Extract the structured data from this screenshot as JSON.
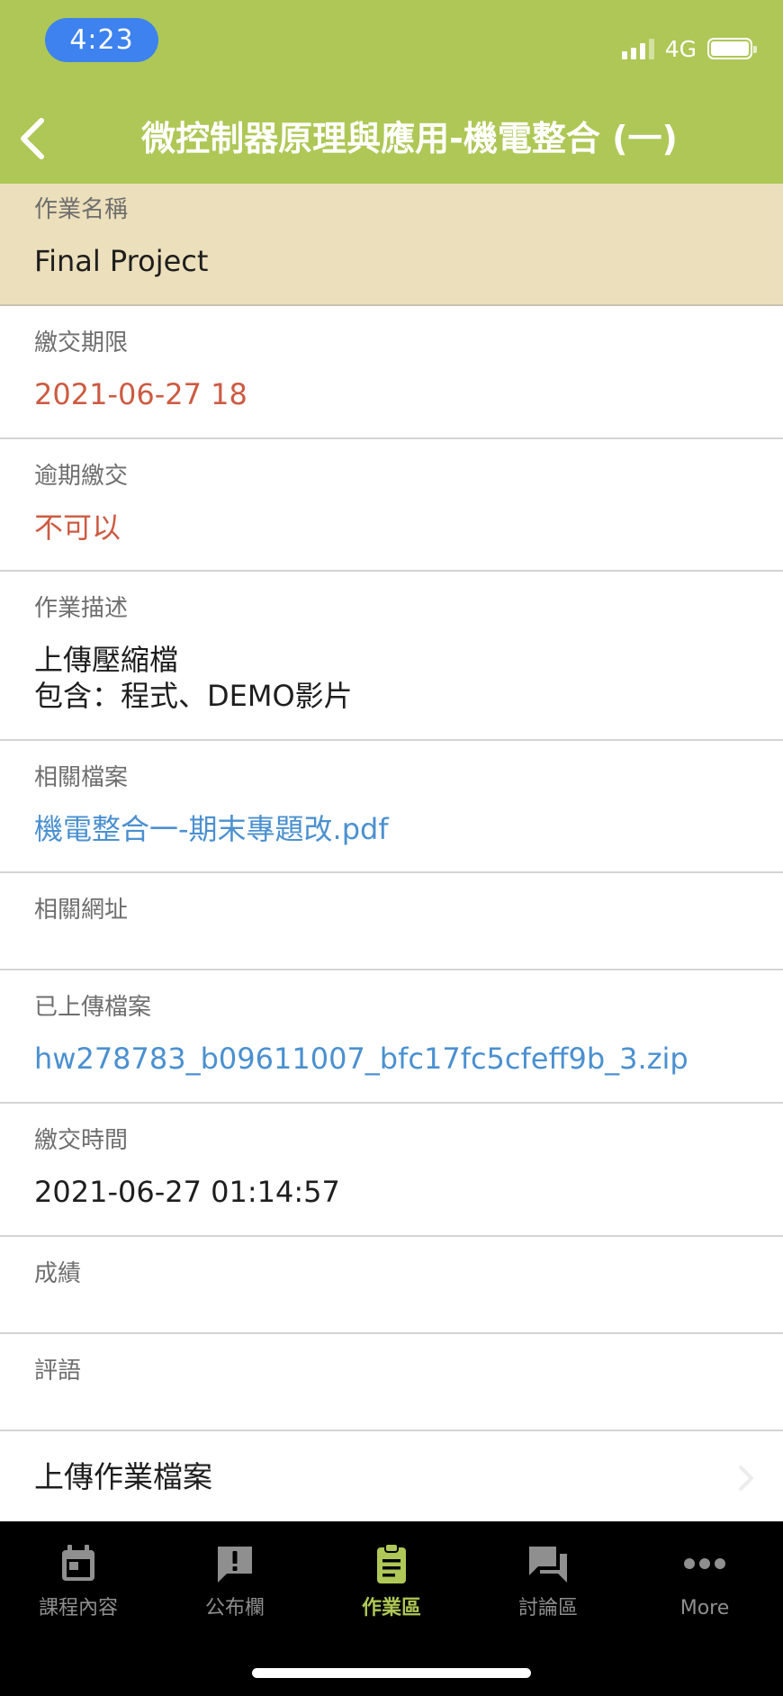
{
  "status_bar": {
    "time": "4:23",
    "network": "4G"
  },
  "header": {
    "title": "微控制器原理與應用-機電整合 (一)",
    "background_color": "#aec756",
    "back_icon": "chevron-left-icon"
  },
  "assignment": {
    "name_label": "作業名稱",
    "name_value": "Final Project",
    "deadline_label": "繳交期限",
    "deadline_value": "2021-06-27 18",
    "late_label": "逾期繳交",
    "late_value": "不可以",
    "description_label": "作業描述",
    "description_line1": "上傳壓縮檔",
    "description_line2": "包含：程式、DEMO影片",
    "files_label": "相關檔案",
    "files_value": "機電整合一-期末專題改.pdf",
    "urls_label": "相關網址",
    "urls_value": "",
    "uploaded_label": "已上傳檔案",
    "uploaded_value": "hw278783_b09611007_bfc17fc5cfeff9b_3.zip",
    "submit_time_label": "繳交時間",
    "submit_time_value": "2021-06-27 01:14:57",
    "grade_label": "成績",
    "grade_value": "",
    "comment_label": "評語",
    "comment_value": "",
    "upload_action": "上傳作業檔案"
  },
  "tabbar": {
    "tabs": [
      {
        "label": "課程內容",
        "icon": "calendar-icon"
      },
      {
        "label": "公布欄",
        "icon": "announcement-icon"
      },
      {
        "label": "作業區",
        "icon": "clipboard-icon",
        "active": true
      },
      {
        "label": "討論區",
        "icon": "forum-icon"
      },
      {
        "label": "More",
        "icon": "more-icon"
      }
    ],
    "active_color": "#aec756",
    "inactive_color": "#8f8f8f"
  }
}
